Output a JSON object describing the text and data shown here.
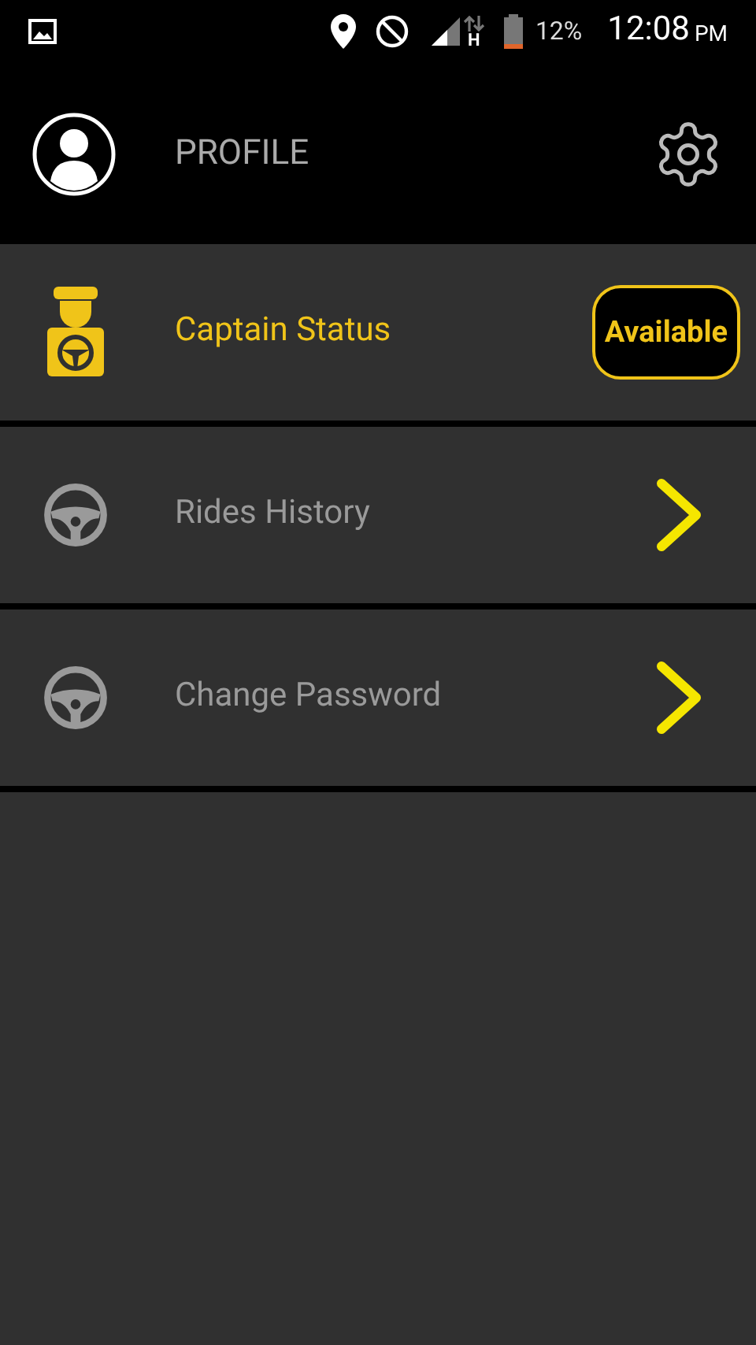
{
  "status_bar": {
    "network_type": "H",
    "battery": "12%",
    "time": "12:08",
    "meridiem": "PM"
  },
  "header": {
    "title": "PROFILE"
  },
  "menu": [
    {
      "kind": "status",
      "label": "Captain Status",
      "badge": "Available"
    },
    {
      "kind": "link",
      "label": "Rides History"
    },
    {
      "kind": "link",
      "label": "Change Password"
    }
  ]
}
